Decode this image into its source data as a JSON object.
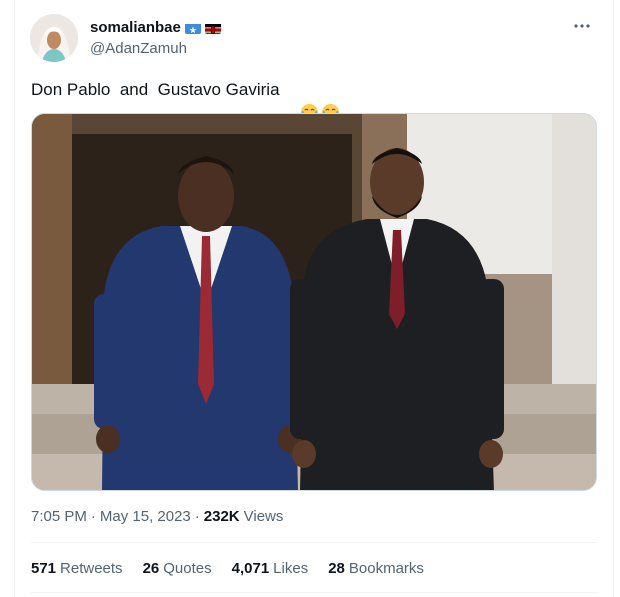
{
  "author": {
    "display_name": "somalianbae",
    "handle": "@AdanZamuh",
    "flags": [
      "somalia-flag-icon",
      "kenya-flag-icon"
    ]
  },
  "tweet": {
    "text": "Don Pablo  and  Gustavo Gaviria",
    "emojis": [
      "laughing-tears-emoji-icon",
      "laughing-tears-emoji-icon"
    ]
  },
  "meta": {
    "time": "7:05 PM",
    "separator": "·",
    "date": "May 15, 2023",
    "views_count": "232K",
    "views_label": "Views"
  },
  "stats": [
    {
      "count": "571",
      "label": "Retweets"
    },
    {
      "count": "26",
      "label": "Quotes"
    },
    {
      "count": "4,071",
      "label": "Likes"
    },
    {
      "count": "28",
      "label": "Bookmarks"
    }
  ],
  "colors": {
    "text": "#0f1419",
    "secondary": "#536471",
    "border": "#eff3f4",
    "somalia_blue": "#4189dd",
    "kenya_red": "#bb0000",
    "kenya_green": "#006600"
  }
}
